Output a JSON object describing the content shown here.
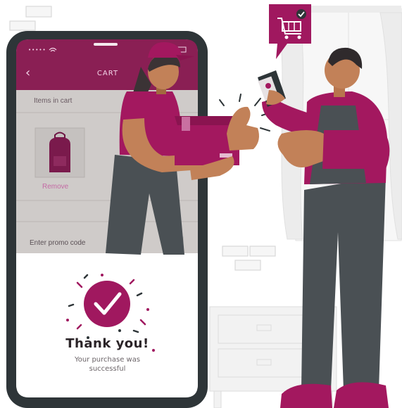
{
  "phone": {
    "header": {
      "title": "CART",
      "back_icon": "chevron-left-icon"
    },
    "status_bar": {
      "signal": "•••••",
      "wifi_icon": "wifi-icon",
      "battery_icon": "battery-icon"
    },
    "cart": {
      "items_label": "Items in cart",
      "item_icon": "backpack-icon",
      "remove_label": "Remove"
    },
    "promo": {
      "label": "Enter promo code"
    },
    "confirmation": {
      "icon": "checkmark-circle-icon",
      "title": "Thank you!",
      "subtitle_line1": "Your purchase was",
      "subtitle_line2": "successful"
    }
  },
  "speech_bubble": {
    "icon": "shopping-cart-check-icon"
  },
  "colors": {
    "accent": "#a0185f",
    "phone_frame": "#2e3538",
    "header": "#8a1f54",
    "overlay": "#d9d6d4",
    "uniform": "#a3185f",
    "overalls": "#4a5054"
  }
}
